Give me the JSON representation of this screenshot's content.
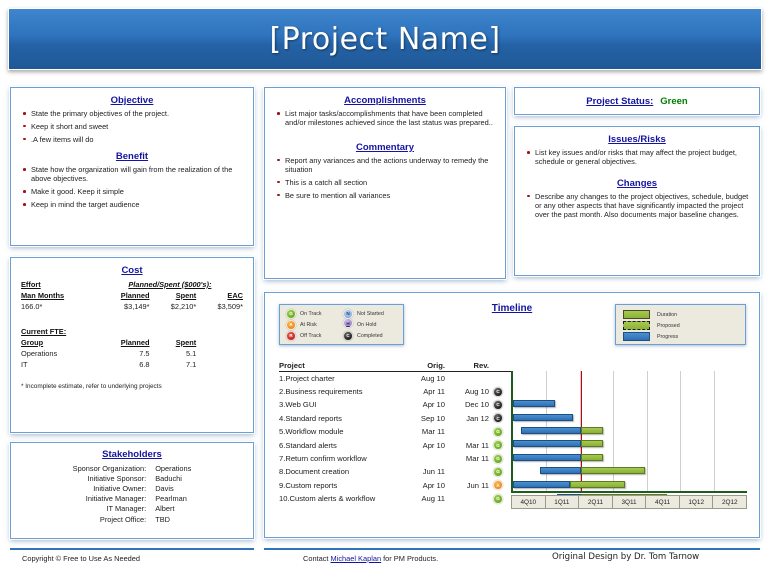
{
  "banner": {
    "title": "[Project Name]"
  },
  "objective": {
    "heading": "Objective",
    "items": [
      "State the primary objectives of the project.",
      "Keep it short and sweet",
      ".A few items will do"
    ],
    "benefit_heading": "Benefit",
    "benefit_items": [
      "State how the organization will gain from the realization of the above objectives.",
      "Make it good.  Keep it simple",
      "Keep in mind the target audience"
    ]
  },
  "cost": {
    "heading": "Cost",
    "effort_label": "Effort",
    "planned_spent_label": "Planned/Spent ($000's):",
    "columns": [
      "Man Months",
      "Planned",
      "Spent",
      "EAC"
    ],
    "values": [
      "166.0*",
      "$3,149*",
      "$2,210*",
      "$3,509*"
    ],
    "fte_label": "Current FTE:",
    "fte_columns": [
      "Group",
      "Planned",
      "Spent"
    ],
    "fte_rows": [
      {
        "group": "Operations",
        "planned": "7.5",
        "spent": "5.1"
      },
      {
        "group": "IT",
        "planned": "6.8",
        "spent": "7.1"
      }
    ],
    "note": "*  Incomplete estimate, refer to underlying projects"
  },
  "stakeholders": {
    "heading": "Stakeholders",
    "rows": [
      {
        "label": "Sponsor Organization:",
        "value": "Operations"
      },
      {
        "label": "Initiative Sponsor:",
        "value": "Baduchi"
      },
      {
        "label": "Initiative Owner:",
        "value": "Davis"
      },
      {
        "label": "Initiative Manager:",
        "value": "Pearlman"
      },
      {
        "label": "IT Manager:",
        "value": "Albert"
      },
      {
        "label": "Project Office:",
        "value": "TBD"
      }
    ]
  },
  "accomplishments": {
    "heading": "Accomplishments",
    "items": [
      "List major tasks/accomplishments that have been completed and/or milestones achieved since the last status was prepared.."
    ],
    "commentary_heading": "Commentary",
    "commentary_items": [
      "Report any variances and the actions underway to remedy the situation",
      "This is a catch all section",
      "Be sure to mention all variances"
    ]
  },
  "status": {
    "label": "Project Status:",
    "value": "Green",
    "value_color": "#008000"
  },
  "issues": {
    "heading": "Issues/Risks",
    "items": [
      "List key issues and/or risks that may affect the project budget, schedule or general objectives."
    ],
    "changes_heading": "Changes",
    "changes_items": [
      "Describe any changes to the project objectives, schedule, budget or any other aspects that have significantly impacted the project over the past month.  Also documents major baseline changes."
    ]
  },
  "timeline": {
    "title": "Timeline",
    "status_legend": [
      {
        "code": "G",
        "label": "On Track",
        "kind": "g"
      },
      {
        "code": "A",
        "label": "At Risk",
        "kind": "a"
      },
      {
        "code": "R",
        "label": "Off Track",
        "kind": "r"
      },
      {
        "code": "N",
        "label": "Not Started",
        "kind": "n"
      },
      {
        "code": "H",
        "label": "On Hold",
        "kind": "h"
      },
      {
        "code": "C",
        "label": "Completed",
        "kind": "c"
      }
    ],
    "bar_legend": [
      {
        "label": "Duration",
        "kind": "dur"
      },
      {
        "label": "Proposed",
        "kind": "prop"
      },
      {
        "label": "Progress",
        "kind": "prog"
      }
    ],
    "columns": {
      "project": "Project",
      "orig": "Orig.",
      "rev": "Rev."
    },
    "rows": [
      {
        "name": "1.Project charter",
        "orig": "Aug 10",
        "rev": "",
        "status": ""
      },
      {
        "name": "2.Business requirements",
        "orig": "Apr 11",
        "rev": "Aug 10",
        "status": "c"
      },
      {
        "name": "3.Web GUI",
        "orig": "Apr 10",
        "rev": "Dec 10",
        "status": "c"
      },
      {
        "name": "4.Standard reports",
        "orig": "Sep 10",
        "rev": "Jan 12",
        "status": "c"
      },
      {
        "name": "5.Workflow module",
        "orig": "Mar 11",
        "rev": "",
        "status": "g"
      },
      {
        "name": "6.Standard alerts",
        "orig": "Apr 10",
        "rev": "Mar 11",
        "status": "g"
      },
      {
        "name": "7.Return confirm workflow",
        "orig": "",
        "rev": "Mar 11",
        "status": "g"
      },
      {
        "name": "8.Document creation",
        "orig": "Jun 11",
        "rev": "",
        "status": "g"
      },
      {
        "name": "9.Custom reports",
        "orig": "Apr 10",
        "rev": "Jun 11",
        "status": "a"
      },
      {
        "name": "10.Custom alerts & workflow",
        "orig": "Aug 11",
        "rev": "",
        "status": "g"
      }
    ],
    "quarters": [
      "4Q10",
      "1Q11",
      "2Q11",
      "3Q11",
      "4Q11",
      "1Q12",
      "2Q12"
    ],
    "today_marker_pct": 29.0
  },
  "chart_data": {
    "type": "bar",
    "title": "Timeline",
    "categories": [
      "4Q10",
      "1Q11",
      "2Q11",
      "3Q11",
      "4Q11",
      "1Q12",
      "2Q12"
    ],
    "xlabel": "",
    "ylabel": "",
    "bars": [
      {
        "row": 0,
        "segments": []
      },
      {
        "row": 1,
        "segments": []
      },
      {
        "row": 2,
        "segments": [
          {
            "kind": "prog",
            "start_pct": 0.0,
            "end_pct": 18.0
          }
        ]
      },
      {
        "row": 3,
        "segments": [
          {
            "kind": "prog",
            "start_pct": 0.0,
            "end_pct": 25.5
          }
        ]
      },
      {
        "row": 4,
        "segments": [
          {
            "kind": "prog",
            "start_pct": 3.5,
            "end_pct": 29.0
          },
          {
            "kind": "dur",
            "start_pct": 29.0,
            "end_pct": 38.5
          }
        ]
      },
      {
        "row": 5,
        "segments": [
          {
            "kind": "prog",
            "start_pct": 0.0,
            "end_pct": 29.0
          },
          {
            "kind": "dur",
            "start_pct": 29.0,
            "end_pct": 38.5
          }
        ]
      },
      {
        "row": 6,
        "segments": [
          {
            "kind": "prog",
            "start_pct": 0.0,
            "end_pct": 29.0
          },
          {
            "kind": "dur",
            "start_pct": 29.0,
            "end_pct": 38.5
          }
        ]
      },
      {
        "row": 7,
        "segments": [
          {
            "kind": "prog",
            "start_pct": 11.5,
            "end_pct": 29.0
          },
          {
            "kind": "dur",
            "start_pct": 29.0,
            "end_pct": 56.5
          }
        ]
      },
      {
        "row": 8,
        "segments": [
          {
            "kind": "prog",
            "start_pct": 0.0,
            "end_pct": 24.5
          },
          {
            "kind": "dur",
            "start_pct": 24.5,
            "end_pct": 48.0
          }
        ]
      },
      {
        "row": 9,
        "segments": [
          {
            "kind": "prog",
            "start_pct": 19.0,
            "end_pct": 29.0
          },
          {
            "kind": "dur",
            "start_pct": 29.0,
            "end_pct": 66.0
          }
        ]
      }
    ]
  },
  "footer": {
    "copyright": "Copyright © Free to Use As Needed",
    "contact_prefix": "Contact ",
    "contact_link": "Michael Kaplan",
    "contact_suffix": " for PM Products.",
    "design": "Original Design by Dr. Tom Tarnow"
  }
}
